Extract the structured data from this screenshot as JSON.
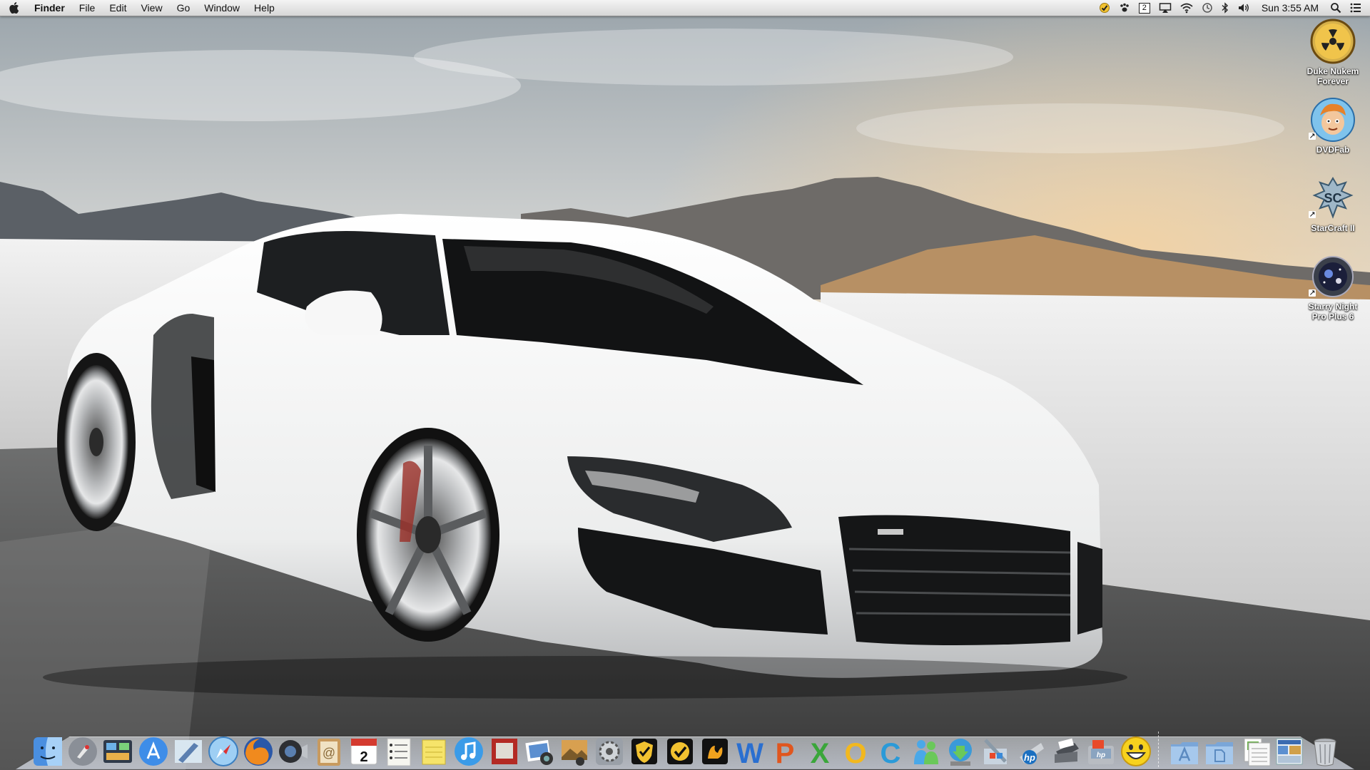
{
  "menubar": {
    "app_name": "Finder",
    "menus": [
      "File",
      "Edit",
      "View",
      "Go",
      "Window",
      "Help"
    ],
    "spaces_number": "2",
    "clock": "Sun 3:55 AM",
    "extras": [
      "norton-check-icon",
      "paw-icon",
      "spaces-icon",
      "airplay-icon",
      "wifi-icon",
      "time-machine-icon",
      "bluetooth-icon",
      "volume-icon",
      "spotlight-icon",
      "notifications-list-icon"
    ]
  },
  "desktop": {
    "icons": [
      {
        "label": "Duke Nukem Forever",
        "line1": "Duke Nukem",
        "line2": "Forever",
        "alias": false
      },
      {
        "label": "DVDFab",
        "line1": "DVDFab",
        "line2": "",
        "alias": true
      },
      {
        "label": "StarCraft II",
        "line1": "StarCraft II",
        "line2": "",
        "alias": true
      },
      {
        "label": "Starry Night Pro Plus 6",
        "line1": "Starry Night",
        "line2": "Pro Plus 6",
        "alias": true
      }
    ]
  },
  "dock": {
    "apps": [
      "finder-icon",
      "launchpad-icon",
      "mission-control-icon",
      "app-store-icon",
      "mail-icon",
      "safari-icon",
      "firefox-icon",
      "facetime-icon",
      "address-book-icon",
      "ical-icon",
      "reminders-icon",
      "stickies-icon",
      "itunes-icon",
      "photo-booth-icon",
      "iphoto-icon",
      "image-capture-icon",
      "system-preferences-icon",
      "norton-icon",
      "norton-utilities-icon",
      "toast-icon",
      "word-icon",
      "powerpoint-icon",
      "excel-icon",
      "outlook-icon",
      "communicator-icon",
      "messenger-icon",
      "downloader-icon",
      "directory-utility-icon",
      "hp-utility-icon",
      "printer-icon",
      "scanner-icon",
      "yahoo-messenger-icon"
    ],
    "calendar_day": "2",
    "stacks": [
      "applications-stack-icon",
      "documents-stack-icon",
      "downloads-stack-icon",
      "screenshots-stack-icon",
      "trash-icon"
    ]
  },
  "colors": {
    "menubar_bg": "#e6e6e6",
    "car_white": "#f2f2f2",
    "sky": "#c9ccce"
  }
}
